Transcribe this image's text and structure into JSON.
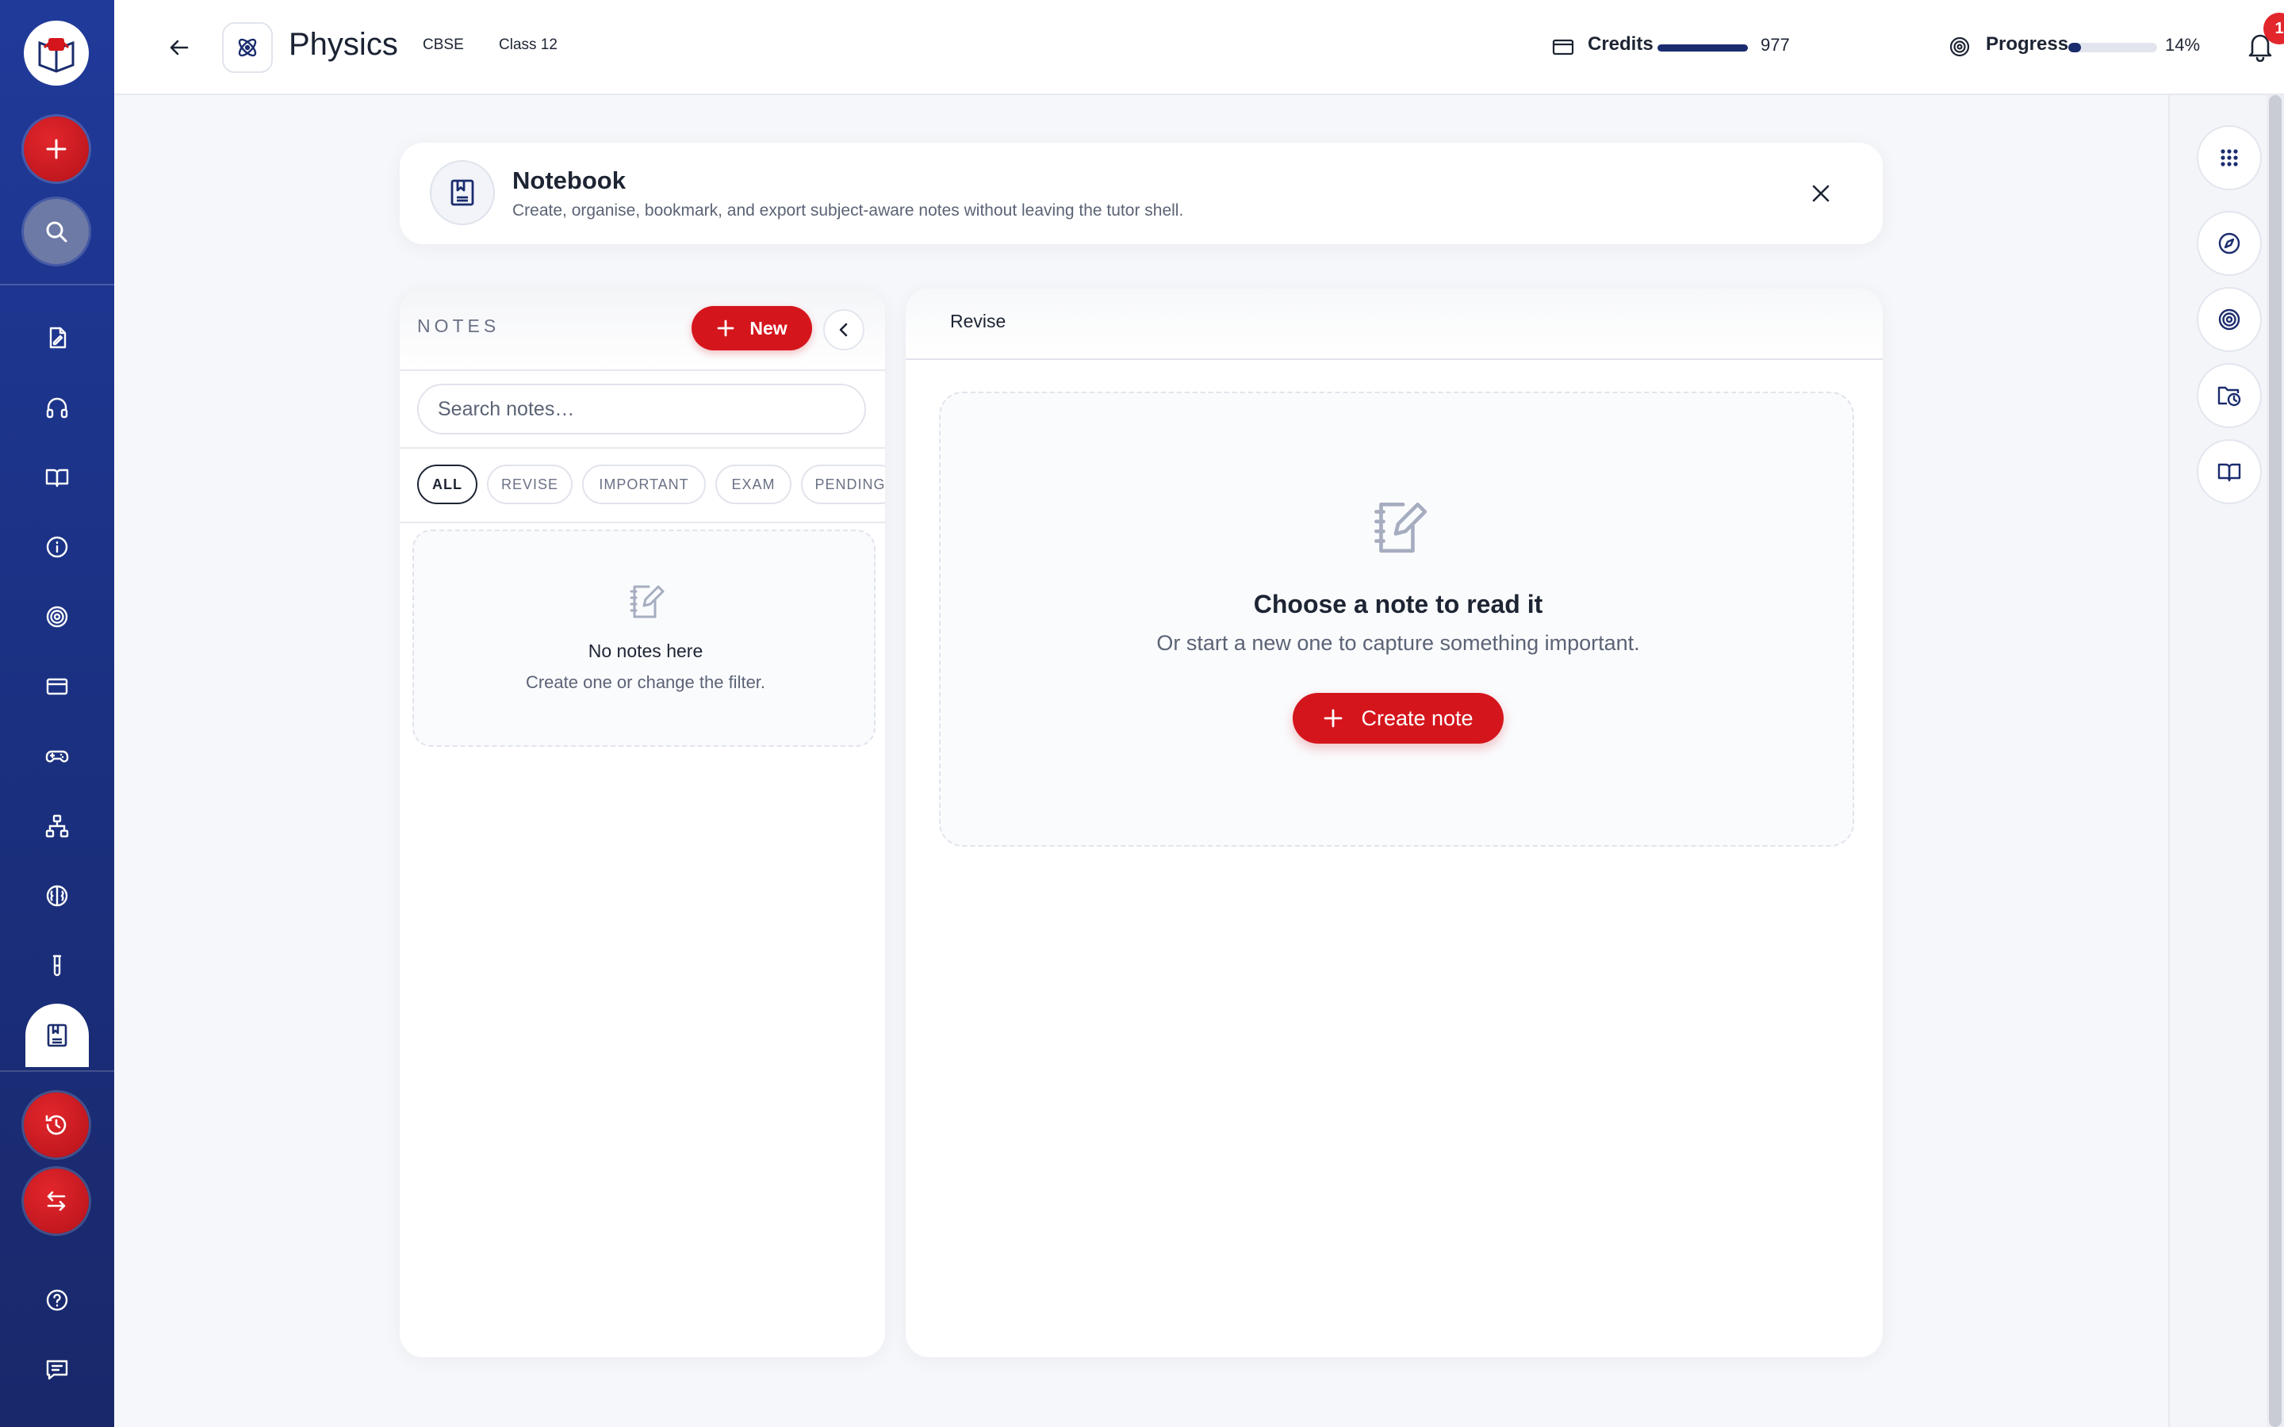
{
  "app": {
    "accent_color": "#d5151c",
    "navy_color": "#1b2c6e"
  },
  "sidebar": {
    "logo_icon": "app-logo",
    "top_actions": [
      {
        "name": "add-button",
        "icon": "plus-icon"
      },
      {
        "name": "search-button",
        "icon": "search-icon"
      }
    ],
    "items": [
      {
        "icon": "file-edit-icon"
      },
      {
        "icon": "headphones-icon"
      },
      {
        "icon": "book-open-icon"
      },
      {
        "icon": "info-icon"
      },
      {
        "icon": "target-icon"
      },
      {
        "icon": "card-icon"
      },
      {
        "icon": "gamepad-icon"
      },
      {
        "icon": "network-icon"
      },
      {
        "icon": "brain-icon"
      },
      {
        "icon": "test-tube-icon"
      },
      {
        "icon": "notebook-icon",
        "active": true
      }
    ],
    "bottom_actions": [
      {
        "icon": "history-icon"
      },
      {
        "icon": "switch-icon"
      }
    ],
    "footer": [
      {
        "icon": "help-icon"
      },
      {
        "icon": "chat-icon"
      }
    ]
  },
  "header": {
    "subject_icon": "atom-icon",
    "title": "Physics",
    "board": "CBSE",
    "class_label": "Class 12",
    "credits_label": "Credits",
    "credits_value": "977",
    "progress_label": "Progress",
    "progress_value": "14%",
    "progress_fraction": 0.14,
    "notification_count": "1"
  },
  "notebook": {
    "title": "Notebook",
    "description": "Create, organise, bookmark, and export subject-aware notes without leaving the tutor shell."
  },
  "notes_panel": {
    "title": "NOTES",
    "new_button": "New",
    "search_placeholder": "Search notes…",
    "filters": [
      "ALL",
      "REVISE",
      "IMPORTANT",
      "EXAM",
      "PENDING"
    ],
    "active_filter": "ALL",
    "empty_title": "No notes here",
    "empty_subtitle": "Create one or change the filter."
  },
  "reader": {
    "tab": "Revise",
    "empty_title": "Choose a note to read it",
    "empty_subtitle": "Or start a new one to capture something important.",
    "create_button": "Create note"
  },
  "right_rail": [
    {
      "icon": "grid-icon"
    },
    {
      "icon": "compass-icon"
    },
    {
      "icon": "target-icon"
    },
    {
      "icon": "folder-clock-icon"
    },
    {
      "icon": "book-open-icon"
    }
  ]
}
